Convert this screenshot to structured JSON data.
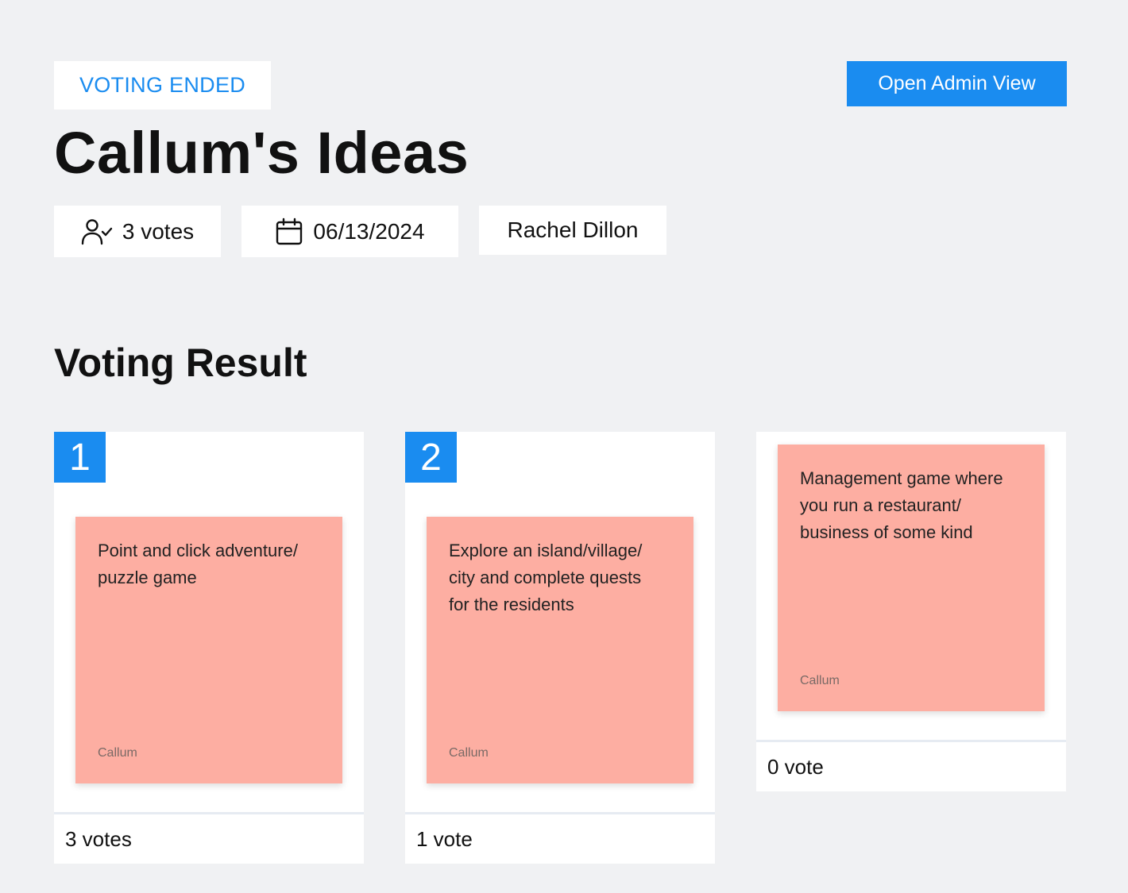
{
  "status": "VOTING ENDED",
  "admin_button": "Open Admin View",
  "title": "Callum's Ideas",
  "meta": {
    "votes": "3 votes",
    "date": "06/13/2024",
    "author": "Rachel Dillon"
  },
  "section_title": "Voting Result",
  "colors": {
    "accent": "#1a8cf0",
    "sticky": "#fdaea2",
    "background": "#f0f1f3"
  },
  "cards": [
    {
      "rank": "1",
      "text_lines": [
        "Point and click adventure/",
        "puzzle game"
      ],
      "author": "Callum",
      "votes": "3 votes"
    },
    {
      "rank": "2",
      "text_lines": [
        "Explore an island/village/",
        "city and complete quests",
        "for the residents"
      ],
      "author": "Callum",
      "votes": "1 vote"
    },
    {
      "rank": "",
      "text_lines": [
        "Management game where",
        "you run a restaurant/",
        "business of some kind"
      ],
      "author": "Callum",
      "votes": "0 vote"
    }
  ]
}
